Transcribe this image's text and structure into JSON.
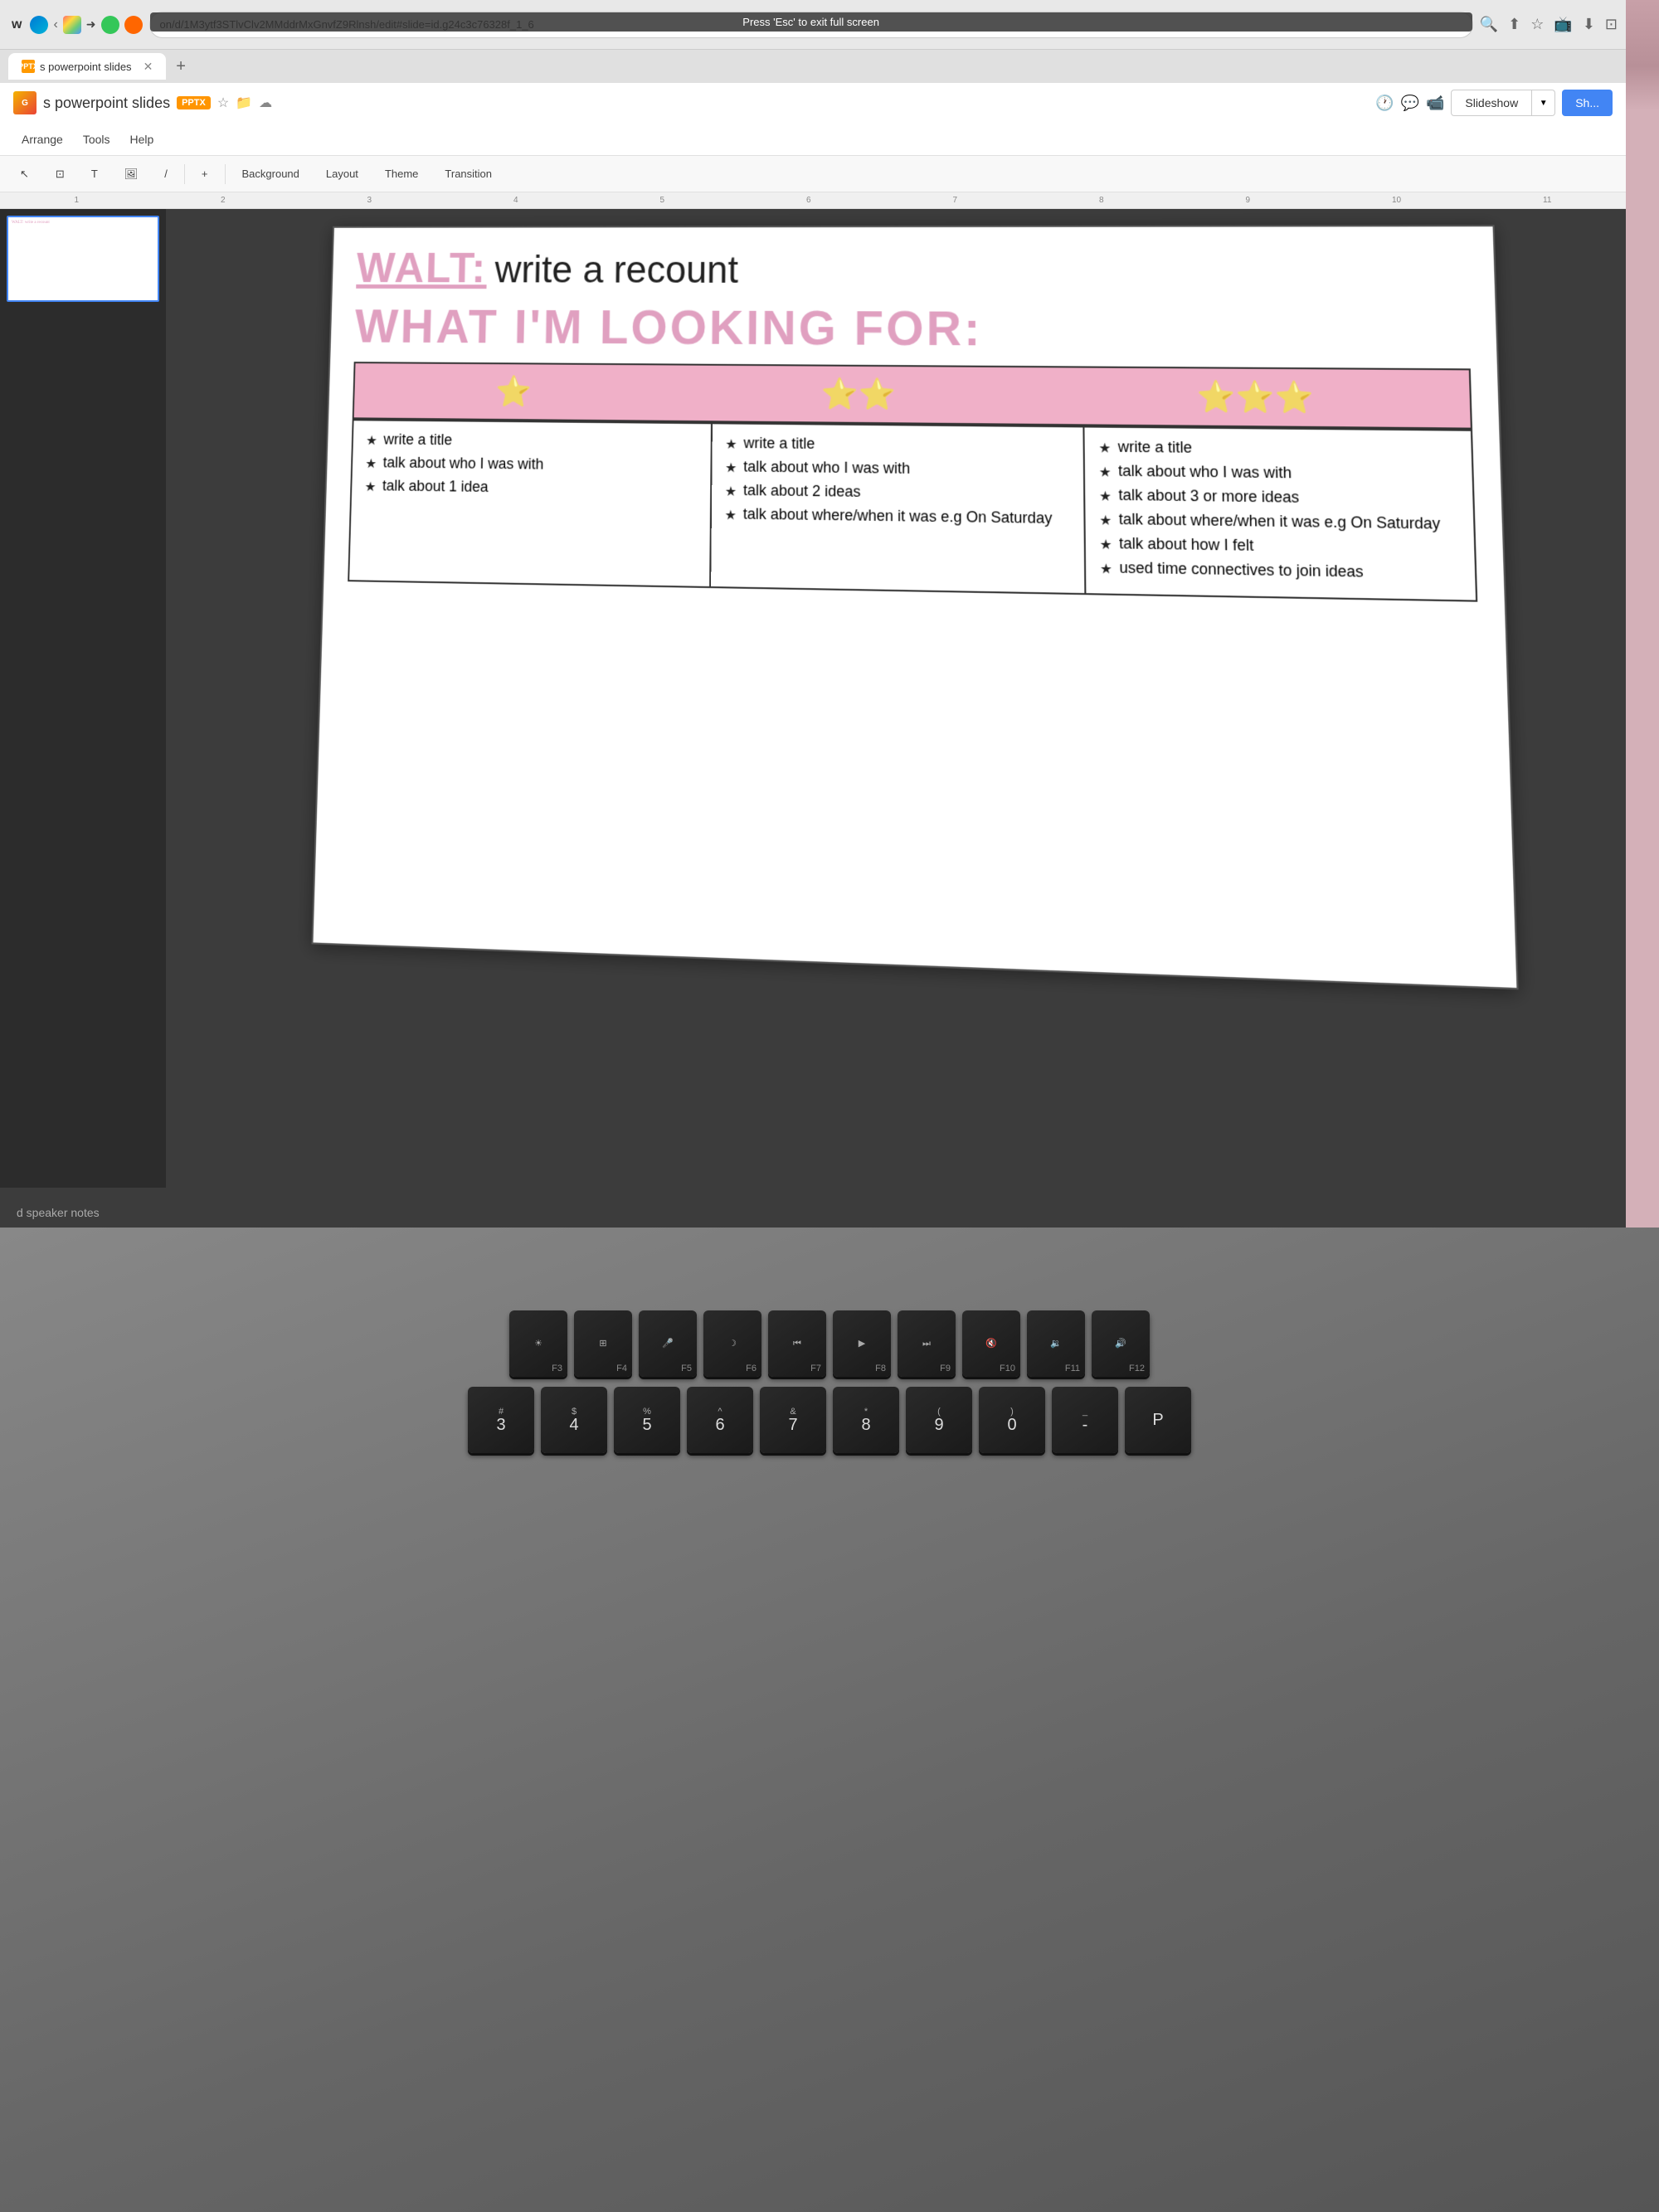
{
  "browser": {
    "url": "on/d/1M3ytf3STlvClv2MMddrMxGnvfZ9Rlnsh/edit#slide=id.g24c3c76328f_1_6",
    "notification": "Press 'Esc' to exit full screen",
    "tab_title": "s powerpoint slides",
    "tab_favicon": "PPTX"
  },
  "slides_app": {
    "title": "s powerpoint slides",
    "badge": "PPTX",
    "menu_items": [
      "Arrange",
      "Tools",
      "Help"
    ],
    "toolbar_items": [
      "Background",
      "Layout",
      "Theme",
      "Transition"
    ],
    "slideshow_label": "Slideshow",
    "share_label": "Sh...",
    "speaker_notes_label": "d speaker notes"
  },
  "slide": {
    "walt_label": "WALT:",
    "walt_text": "write a recount",
    "looking_for": "WHAT I'M LOOKING FOR:",
    "columns": [
      {
        "items": [
          "write a title",
          "talk about who I was with",
          "talk about 1 idea"
        ]
      },
      {
        "items": [
          "write a title",
          "talk about who I was with",
          "talk about 2 ideas",
          "talk about where/when it was e.g On Saturday"
        ]
      },
      {
        "items": [
          "write a title",
          "talk about who I was with",
          "talk about 3 or more ideas",
          "talk about where/when it was e.g On Saturday",
          "talk about how I felt",
          "used time connectives to join ideas"
        ]
      }
    ]
  },
  "ruler": {
    "marks": [
      "1",
      "2",
      "3",
      "4",
      "5",
      "6",
      "7",
      "8",
      "9",
      "10",
      "11"
    ]
  },
  "keyboard": {
    "rows": [
      [
        {
          "label": "F3",
          "top": "☀️"
        },
        {
          "label": "F4",
          "top": "□□"
        },
        {
          "label": "F5",
          "top": "🎤"
        },
        {
          "label": "F6",
          "top": "☽"
        },
        {
          "label": "F7",
          "top": "⏪"
        },
        {
          "label": "F8",
          "top": "⏯"
        },
        {
          "label": "F9",
          "top": "⏩"
        },
        {
          "label": "F10",
          "top": "🔇"
        },
        {
          "label": "F11",
          "top": "🔉"
        },
        {
          "label": "F12",
          "top": "🔊"
        }
      ],
      [
        {
          "label": "#",
          "top": ""
        },
        {
          "label": "4",
          "top": "$"
        },
        {
          "label": "5",
          "top": "%"
        },
        {
          "label": "6",
          "top": "^"
        },
        {
          "label": "7",
          "top": "&"
        },
        {
          "label": "8",
          "top": "*"
        },
        {
          "label": "9",
          "top": "("
        },
        {
          "label": "0",
          "top": ")"
        },
        {
          "label": "-",
          "top": "_"
        },
        {
          "label": "P",
          "top": ""
        }
      ]
    ]
  }
}
